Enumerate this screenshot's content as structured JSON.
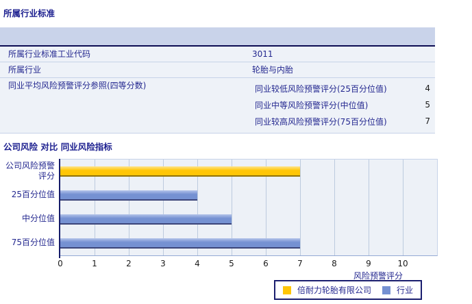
{
  "industry_section": {
    "title": "所属行业标准",
    "table": {
      "rows": [
        {
          "label": "所属行业标准工业代码",
          "value": "3011"
        },
        {
          "label": "所属行业",
          "value": "轮胎与内胎"
        },
        {
          "label": "同业平均风险预警评分参照(四等分数)",
          "sub_rows": [
            {
              "label": "同业较低风险预警评分(25百分位值)",
              "value": "4"
            },
            {
              "label": "同业中等风险预警评分(中位值)",
              "value": "5"
            },
            {
              "label": "同业较高风险预警评分(75百分位值)",
              "value": "7"
            }
          ]
        }
      ]
    }
  },
  "chart_section": {
    "title": "公司风险 对比 同业风险指标"
  },
  "chart_data": {
    "type": "bar",
    "orientation": "horizontal",
    "title": "公司风险 对比 同业风险指标",
    "xlabel": "风险预警评分",
    "xlim": [
      0,
      11
    ],
    "xticks": [
      0,
      1,
      2,
      3,
      4,
      5,
      6,
      7,
      8,
      9,
      10
    ],
    "grid": true,
    "legend_position": "bottom-right",
    "categories": [
      "公司风险预警评分",
      "25百分位值",
      "中分位值",
      "75百分位值"
    ],
    "bars": [
      {
        "category": "公司风险预警评分",
        "series": "倍耐力轮胎有限公司",
        "value": 7
      },
      {
        "category": "25百分位值",
        "series": "行业",
        "value": 4
      },
      {
        "category": "中分位值",
        "series": "行业",
        "value": 5
      },
      {
        "category": "75百分位值",
        "series": "行业",
        "value": 7
      }
    ],
    "series": [
      {
        "name": "倍耐力轮胎有限公司",
        "color": "#ffc607",
        "highlight": "#ffe489",
        "edge": "#8f7200"
      },
      {
        "name": "行业",
        "color": "#7591d2",
        "highlight": "#b4c4ea",
        "edge": "#3c4579"
      }
    ]
  },
  "colors": {
    "title_text": "#1e2190",
    "table_header_bg": "#c9d3ea",
    "table_header_border": "#0c0c52",
    "row_bg": "#eef2f8",
    "row_border": "#c6d2e8",
    "value_text": "#1a1a1a",
    "plot_bg": "#edf1f7",
    "gridline": "#bccade",
    "y_axis": "#151b69",
    "x_axis": "#93a9d4",
    "legend_border": "#191d6e"
  }
}
